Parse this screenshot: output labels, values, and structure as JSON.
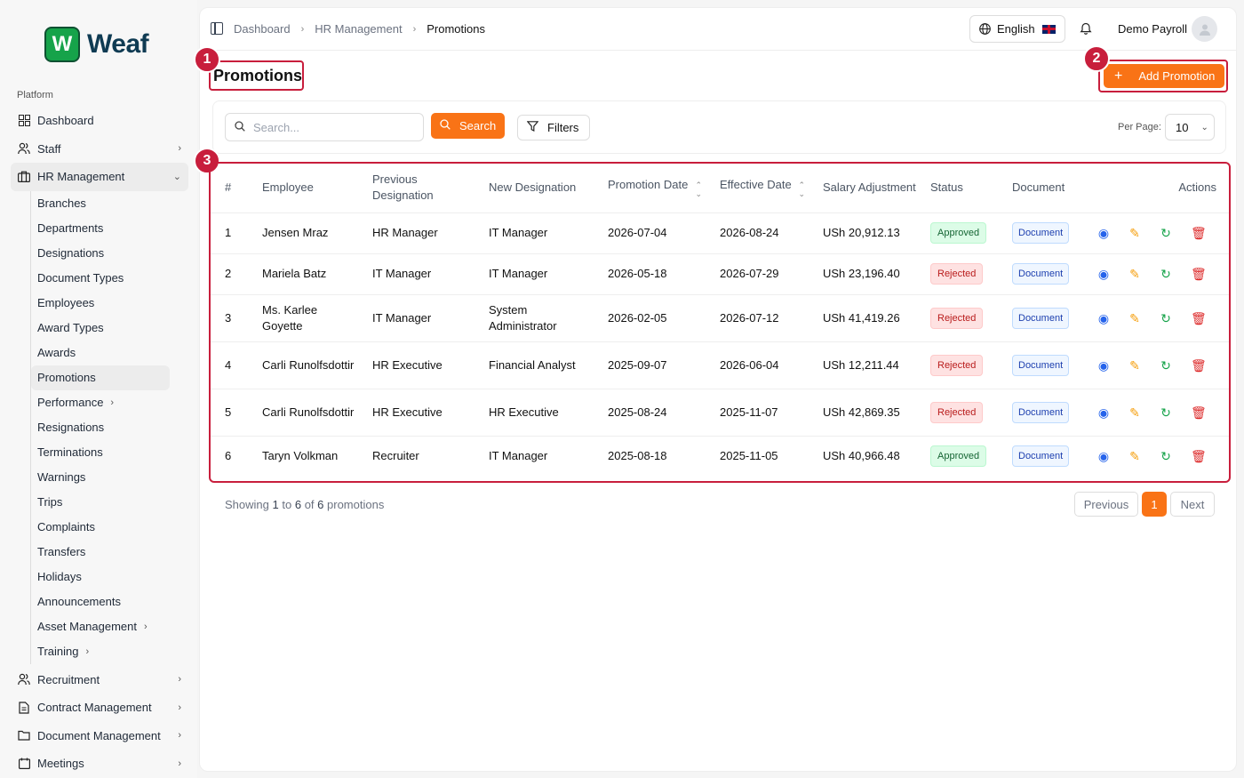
{
  "brand": {
    "name": "Weaf",
    "badge": "W"
  },
  "sidebar": {
    "section_label": "Platform",
    "items": [
      {
        "label": "Dashboard",
        "icon": "grid-icon"
      },
      {
        "label": "Staff",
        "icon": "users-icon"
      },
      {
        "label": "HR Management",
        "icon": "briefcase-icon"
      }
    ],
    "hr_submenu": [
      "Branches",
      "Departments",
      "Designations",
      "Document Types",
      "Employees",
      "Award Types",
      "Awards",
      "Promotions",
      "Performance",
      "Resignations",
      "Terminations",
      "Warnings",
      "Trips",
      "Complaints",
      "Transfers",
      "Holidays",
      "Announcements",
      "Asset Management",
      "Training"
    ],
    "bottom_items": [
      {
        "label": "Recruitment",
        "icon": "users-icon"
      },
      {
        "label": "Contract Management",
        "icon": "file-icon"
      },
      {
        "label": "Document Management",
        "icon": "folder-icon"
      },
      {
        "label": "Meetings",
        "icon": "calendar-icon"
      }
    ]
  },
  "header": {
    "breadcrumbs": [
      "Dashboard",
      "HR Management",
      "Promotions"
    ],
    "language": "English",
    "user_name": "Demo Payroll"
  },
  "page": {
    "title": "Promotions",
    "add_button": "Add Promotion",
    "markers": [
      "1",
      "2",
      "3"
    ]
  },
  "filters": {
    "search_placeholder": "Search...",
    "search_button": "Search",
    "filters_button": "Filters",
    "per_page_label": "Per Page:",
    "per_page_value": "10"
  },
  "table": {
    "columns": [
      "#",
      "Employee",
      "Previous Designation",
      "New Designation",
      "Promotion Date",
      "Effective Date",
      "Salary Adjustment",
      "Status",
      "Document",
      "Actions"
    ],
    "rows": [
      {
        "n": "1",
        "employee": "Jensen Mraz",
        "prev": "HR Manager",
        "new": "IT Manager",
        "promo": "2026-07-04",
        "effective": "2026-08-24",
        "salary": "USh 20,912.13",
        "status": "Approved",
        "doc": "Document"
      },
      {
        "n": "2",
        "employee": "Mariela Batz",
        "prev": "IT Manager",
        "new": "IT Manager",
        "promo": "2026-05-18",
        "effective": "2026-07-29",
        "salary": "USh 23,196.40",
        "status": "Rejected",
        "doc": "Document"
      },
      {
        "n": "3",
        "employee": "Ms. Karlee Goyette",
        "prev": "IT Manager",
        "new": "System Administrator",
        "promo": "2026-02-05",
        "effective": "2026-07-12",
        "salary": "USh 41,419.26",
        "status": "Rejected",
        "doc": "Document"
      },
      {
        "n": "4",
        "employee": "Carli Runolfsdottir",
        "prev": "HR Executive",
        "new": "Financial Analyst",
        "promo": "2025-09-07",
        "effective": "2026-06-04",
        "salary": "USh 12,211.44",
        "status": "Rejected",
        "doc": "Document"
      },
      {
        "n": "5",
        "employee": "Carli Runolfsdottir",
        "prev": "HR Executive",
        "new": "HR Executive",
        "promo": "2025-08-24",
        "effective": "2025-11-07",
        "salary": "USh 42,869.35",
        "status": "Rejected",
        "doc": "Document"
      },
      {
        "n": "6",
        "employee": "Taryn Volkman",
        "prev": "Recruiter",
        "new": "IT Manager",
        "promo": "2025-08-18",
        "effective": "2025-11-05",
        "salary": "USh 40,966.48",
        "status": "Approved",
        "doc": "Document"
      }
    ]
  },
  "footer": {
    "showing_prefix": "Showing",
    "from": "1",
    "to_word": "to",
    "to": "6",
    "of_word": "of",
    "total": "6",
    "suffix": "promotions",
    "prev": "Previous",
    "page": "1",
    "next": "Next"
  },
  "colors": {
    "accent": "#f97316",
    "annotation": "#c81e3c",
    "brand": "#16a34a"
  }
}
